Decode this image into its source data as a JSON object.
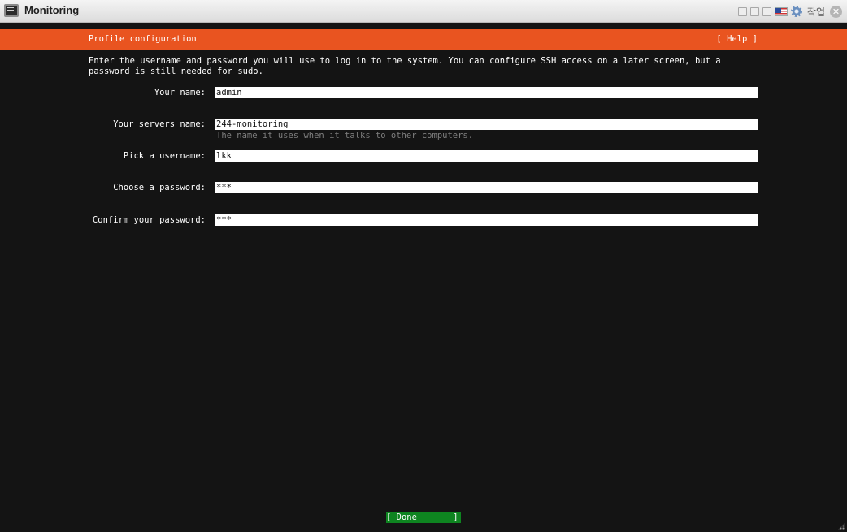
{
  "window": {
    "title": "Monitoring",
    "task_label": "작업",
    "close_symbol": "✕"
  },
  "header": {
    "title": "Profile configuration",
    "help_label": "[ Help ]",
    "background_color": "#e95420"
  },
  "intro": {
    "text": "Enter the username and password you will use to log in to the system. You can configure SSH access on a later screen, but a\npassword is still needed for sudo."
  },
  "form": {
    "your_name": {
      "label": "Your name:",
      "value": "admin"
    },
    "server_name": {
      "label": "Your servers name:",
      "value": "244-monitoring",
      "hint": "The name it uses when it talks to other computers."
    },
    "username": {
      "label": "Pick a username:",
      "value": "lkk"
    },
    "password": {
      "label": "Choose a password:",
      "value": "***"
    },
    "confirm_password": {
      "label": "Confirm your password:",
      "value": "***"
    }
  },
  "footer": {
    "done_open": "[ ",
    "done_label": "Done",
    "done_close": "       ]",
    "done_color": "#0e8420"
  },
  "icons": [
    "terminal-app-icon",
    "gear-icon",
    "flag-icon",
    "close-icon",
    "resize-grip-icon"
  ]
}
